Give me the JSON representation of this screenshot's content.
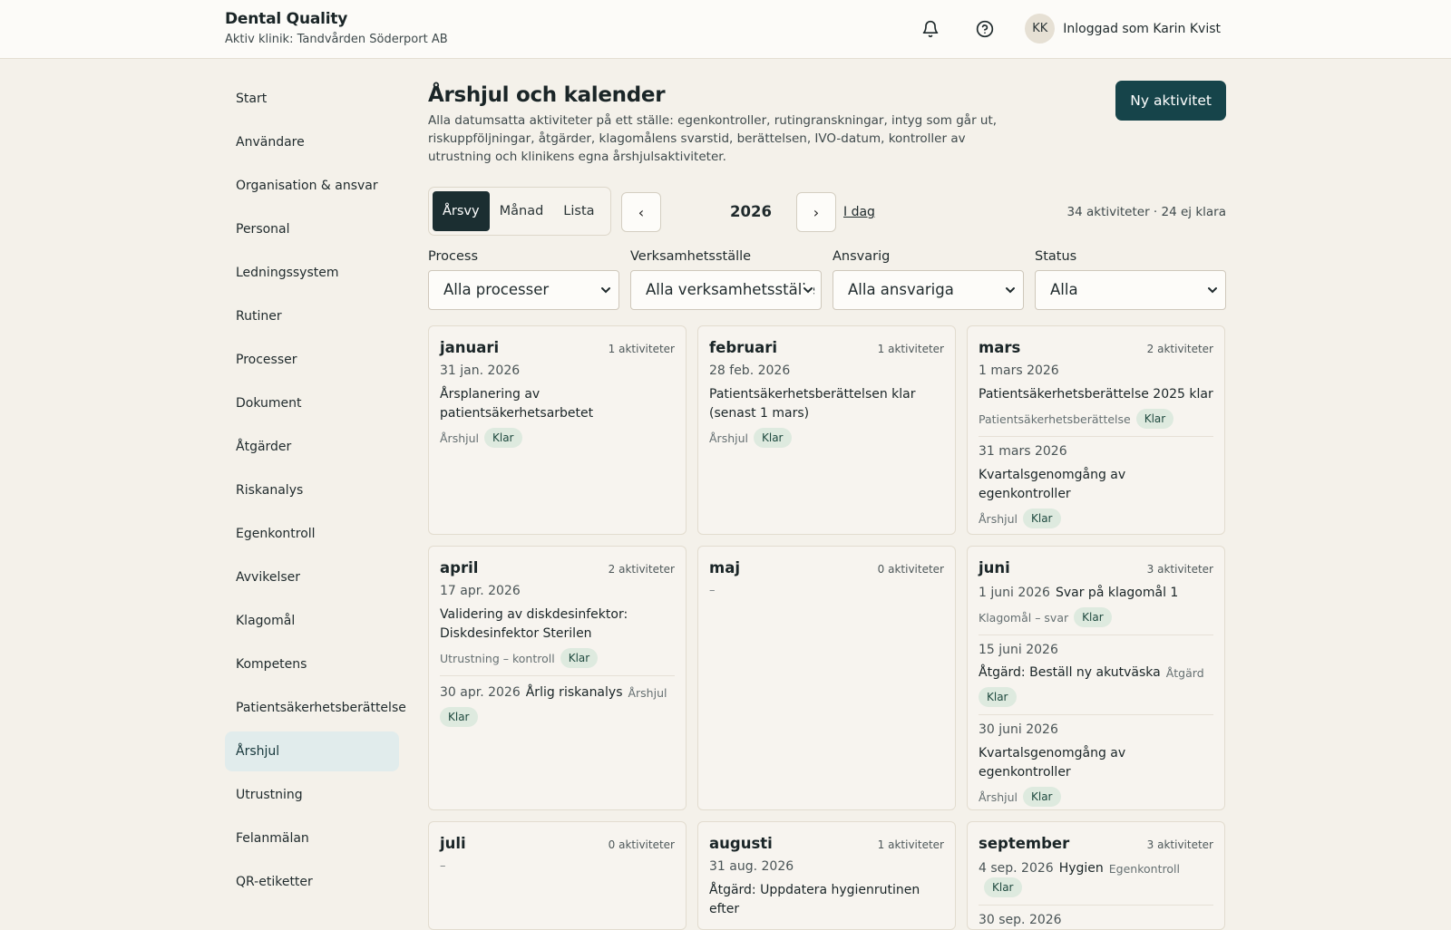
{
  "app": {
    "name": "Dental Quality",
    "clinic": "Aktiv klinik: Tandvården Söderport AB",
    "user_initials": "KK",
    "user_label": "Inloggad som Karin Kvist",
    "icons": {
      "notifications": "bell-icon",
      "help": "help-icon"
    }
  },
  "sidebar": {
    "items": [
      {
        "label": "Start"
      },
      {
        "label": "Användare"
      },
      {
        "label": "Organisation & ansvar"
      },
      {
        "label": "Personal"
      },
      {
        "label": "Ledningssystem"
      },
      {
        "label": "Rutiner"
      },
      {
        "label": "Processer"
      },
      {
        "label": "Dokument"
      },
      {
        "label": "Åtgärder"
      },
      {
        "label": "Riskanalys"
      },
      {
        "label": "Egenkontroll"
      },
      {
        "label": "Avvikelser"
      },
      {
        "label": "Klagomål"
      },
      {
        "label": "Kompetens"
      },
      {
        "label": "Patientsäkerhetsberättelse"
      },
      {
        "label": "Årshjul",
        "active": true
      },
      {
        "label": "Utrustning"
      },
      {
        "label": "Felanmälan"
      },
      {
        "label": "QR-etiketter"
      }
    ]
  },
  "page": {
    "title": "Årshjul och kalender",
    "description": "Alla datumsatta aktiviteter på ett ställe: egenkontroller, rutingranskningar, intyg som går ut, riskuppföljningar, åtgärder, klagomålens svarstid, berättelsen, IVO-datum, kontroller av utrustning och klinikens egna årshjulsaktiviteter.",
    "new_button": "Ny aktivitet"
  },
  "toolbar": {
    "views": [
      {
        "label": "Årsvy",
        "active": true
      },
      {
        "label": "Månad",
        "active": false
      },
      {
        "label": "Lista",
        "active": false
      }
    ],
    "prev": "‹",
    "next": "›",
    "year": "2026",
    "today": "I dag",
    "summary": "34 aktiviteter · 24 ej klara"
  },
  "filters": [
    {
      "label": "Process",
      "value": "Alla processer"
    },
    {
      "label": "Verksamhetsställe",
      "value": "Alla verksamhetsställe"
    },
    {
      "label": "Ansvarig",
      "value": "Alla ansvariga"
    },
    {
      "label": "Status",
      "value": "Alla"
    }
  ],
  "months": [
    {
      "name": "januari",
      "count": "1 aktiviteter",
      "activities": [
        {
          "date": "31 jan. 2026",
          "title": "Årsplanering av patientsäkerhetsarbetet",
          "category": "Årshjul",
          "status": "Klar",
          "layout": "block"
        }
      ]
    },
    {
      "name": "februari",
      "count": "1 aktiviteter",
      "activities": [
        {
          "date": "28 feb. 2026",
          "title": "Patientsäkerhetsberättelsen klar (senast 1 mars)",
          "category": "Årshjul",
          "status": "Klar",
          "layout": "block"
        }
      ]
    },
    {
      "name": "mars",
      "count": "2 aktiviteter",
      "activities": [
        {
          "date": "1 mars 2026",
          "title": "Patientsäkerhetsberättelse 2025 klar",
          "category": "Patientsäkerhetsberättelse",
          "status": "Klar",
          "layout": "block"
        },
        {
          "date": "31 mars 2026",
          "title": "Kvartalsgenomgång av egenkontroller",
          "category": "Årshjul",
          "status": "Klar",
          "layout": "block"
        }
      ]
    },
    {
      "name": "april",
      "count": "2 aktiviteter",
      "activities": [
        {
          "date": "17 apr. 2026",
          "title": "Validering av diskdesinfektor: Diskdesinfektor Sterilen",
          "category": "Utrustning – kontroll",
          "status": "Klar",
          "layout": "block"
        },
        {
          "date": "30 apr. 2026",
          "title": "Årlig riskanalys",
          "category": "Årshjul",
          "status": "Klar",
          "layout": "inline"
        }
      ]
    },
    {
      "name": "maj",
      "count": "0 aktiviteter",
      "empty": "–",
      "activities": []
    },
    {
      "name": "juni",
      "count": "3 aktiviteter",
      "activities": [
        {
          "date": "1 juni 2026",
          "title": "Svar på klagomål 1",
          "category": "Klagomål – svar",
          "status": "Klar",
          "layout": "inline-top"
        },
        {
          "date": "15 juni 2026",
          "title": "Åtgärd: Beställ ny akutväska",
          "category": "Åtgärd",
          "status": "Klar",
          "layout": "block-inline-cat"
        },
        {
          "date": "30 juni 2026",
          "title": "Kvartalsgenomgång av egenkontroller",
          "category": "Årshjul",
          "status": "Klar",
          "layout": "block"
        }
      ]
    },
    {
      "name": "juli",
      "count": "0 aktiviteter",
      "empty": "–",
      "activities": []
    },
    {
      "name": "augusti",
      "count": "1 aktiviteter",
      "activities": [
        {
          "date": "31 aug. 2026",
          "title": "Åtgärd: Uppdatera hygienrutinen efter",
          "category": "",
          "status": "",
          "layout": "block"
        }
      ]
    },
    {
      "name": "september",
      "count": "3 aktiviteter",
      "activities": [
        {
          "date": "4 sep. 2026",
          "title": "Hygien",
          "category": "Egenkontroll",
          "status": "Klar",
          "layout": "inline"
        },
        {
          "date": "30 sep. 2026",
          "title": "",
          "category": "",
          "status": "",
          "layout": "block"
        }
      ]
    }
  ]
}
